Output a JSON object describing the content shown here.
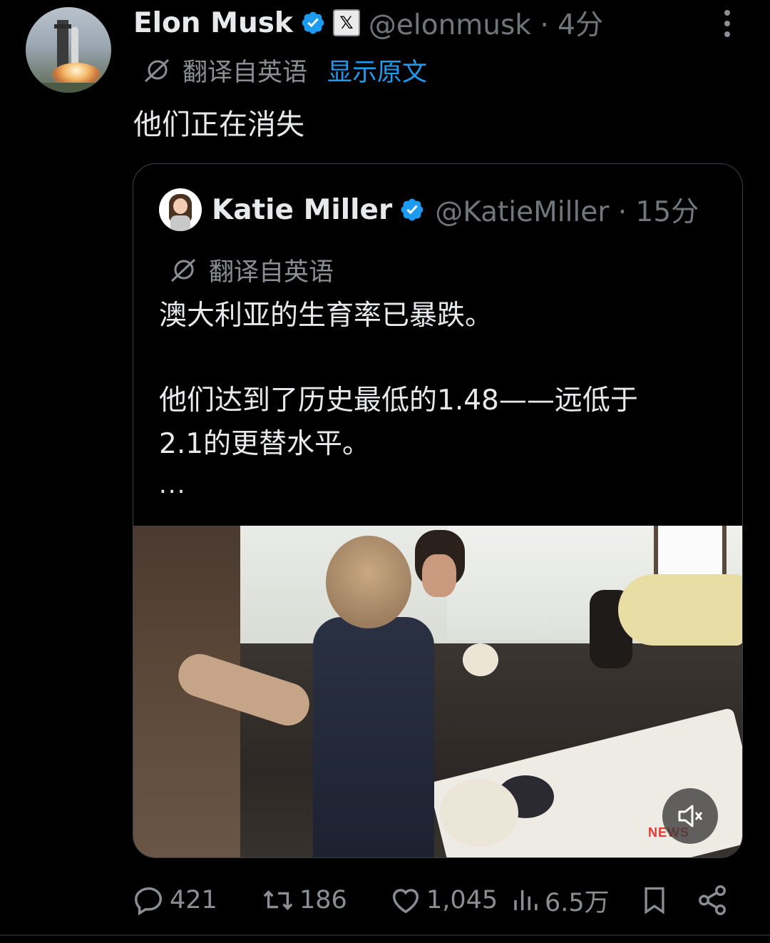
{
  "tweet": {
    "author": {
      "name": "Elon Musk",
      "handle": "@elonmusk",
      "time": "4分",
      "x_badge": "𝕏"
    },
    "translation": {
      "label": "翻译自英语",
      "show_original": "显示原文"
    },
    "text": "他们正在消失"
  },
  "quote": {
    "author": {
      "name": "Katie Miller",
      "handle": "@KatieMiller",
      "time": "15分"
    },
    "translation_label": "翻译自英语",
    "text_line1": "澳大利亚的生育率已暴跌。",
    "text_line2": "他们达到了历史最低的1.48——远低于",
    "text_line3": "2.1的更替水平。",
    "ellipsis": "...",
    "video": {
      "logo": "NEWS"
    }
  },
  "actions": {
    "replies": "421",
    "retweets": "186",
    "likes": "1,045",
    "views": "6.5万"
  },
  "icons": {
    "verified": "verified-badge-icon",
    "translate": "translate-icon",
    "mute": "mute-icon",
    "reply": "reply-icon",
    "retweet": "retweet-icon",
    "like": "heart-icon",
    "views": "views-icon",
    "bookmark": "bookmark-icon",
    "share": "share-icon",
    "more": "more-icon"
  },
  "colors": {
    "accent": "#1d9bf0",
    "muted": "#71767b",
    "text": "#e7e9ea",
    "background": "#000000"
  }
}
